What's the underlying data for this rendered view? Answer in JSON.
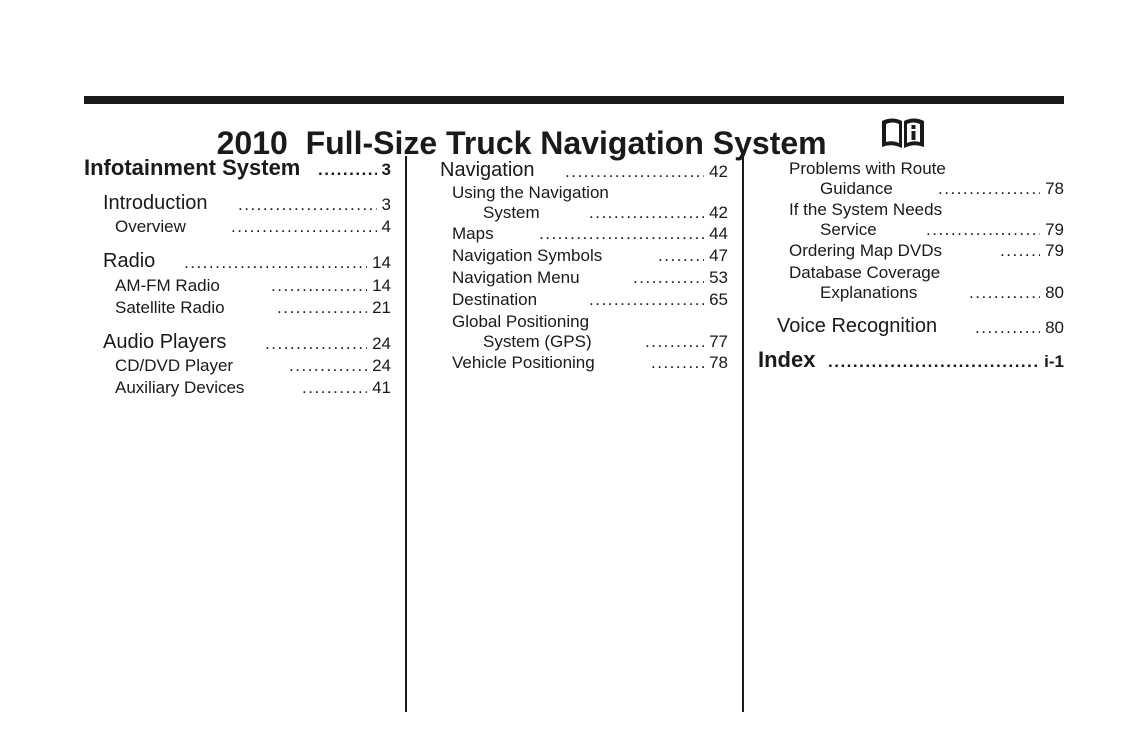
{
  "header": {
    "title": "2010  Full-Size Truck Navigation System",
    "icon": "book-info-icon"
  },
  "columns": [
    {
      "entries": [
        {
          "label": "Infotainment System",
          "page": "3",
          "level": "section"
        },
        {
          "label": "Introduction",
          "page": "3",
          "level": "chapter"
        },
        {
          "label": "Overview",
          "page": "4",
          "level": "topic"
        },
        {
          "label": "Radio",
          "page": "14",
          "level": "chapter"
        },
        {
          "label": "AM-FM Radio",
          "page": "14",
          "level": "topic"
        },
        {
          "label": "Satellite Radio",
          "page": "21",
          "level": "topic"
        },
        {
          "label": "Audio Players",
          "page": "24",
          "level": "chapter"
        },
        {
          "label": "CD/DVD Player",
          "page": "24",
          "level": "topic"
        },
        {
          "label": "Auxiliary Devices",
          "page": "41",
          "level": "topic"
        }
      ]
    },
    {
      "entries": [
        {
          "label": "Navigation",
          "page": "42",
          "level": "chapter"
        },
        {
          "label": "Using the Navigation",
          "label2": "System",
          "page": "42",
          "level": "topic"
        },
        {
          "label": "Maps",
          "page": "44",
          "level": "topic"
        },
        {
          "label": "Navigation Symbols",
          "page": "47",
          "level": "topic"
        },
        {
          "label": "Navigation Menu",
          "page": "53",
          "level": "topic"
        },
        {
          "label": "Destination",
          "page": "65",
          "level": "topic"
        },
        {
          "label": "Global Positioning",
          "label2": "System (GPS)",
          "page": "77",
          "level": "topic"
        },
        {
          "label": "Vehicle Positioning",
          "page": "78",
          "level": "topic"
        }
      ]
    },
    {
      "entries": [
        {
          "label": "Problems with Route",
          "label2": "Guidance",
          "page": "78",
          "level": "topic"
        },
        {
          "label": "If the System Needs",
          "label2": "Service",
          "page": "79",
          "level": "topic"
        },
        {
          "label": "Ordering Map DVDs",
          "page": "79",
          "level": "topic"
        },
        {
          "label": "Database Coverage",
          "label2": "Explanations",
          "page": "80",
          "level": "topic"
        },
        {
          "label": "Voice Recognition",
          "page": "80",
          "level": "chapter"
        },
        {
          "label": "Index",
          "page": "i-1",
          "level": "section"
        }
      ]
    }
  ]
}
